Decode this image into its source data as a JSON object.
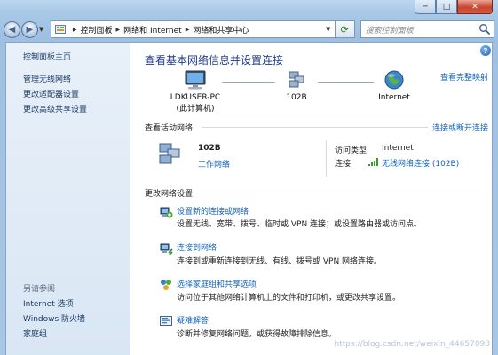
{
  "window": {
    "caption": {
      "minimize": "─",
      "maximize": "□",
      "close": "✕"
    }
  },
  "navbar": {
    "breadcrumbs": [
      "控制面板",
      "网络和 Internet",
      "网络和共享中心"
    ],
    "search_placeholder": "搜索控制面板"
  },
  "sidebar": {
    "home": "控制面板主页",
    "links": [
      "管理无线网络",
      "更改适配器设置",
      "更改高级共享设置"
    ],
    "see_also_heading": "另请参阅",
    "see_also": [
      "Internet 选项",
      "Windows 防火墙",
      "家庭组"
    ]
  },
  "main": {
    "title": "查看基本网络信息并设置连接",
    "full_map": "查看完整映射",
    "network_map": {
      "computer_name": "LDKUSER-PC",
      "computer_note": "(此计算机)",
      "network": "102B",
      "internet": "Internet"
    },
    "active": {
      "heading": "查看活动网络",
      "connect_link": "连接或断开连接",
      "network_name": "102B",
      "network_type": "工作网络",
      "access_type_label": "访问类型:",
      "access_type_value": "Internet",
      "connection_label": "连接:",
      "connection_value": "无线网络连接 (102B)"
    },
    "change": {
      "heading": "更改网络设置",
      "tasks": [
        {
          "link": "设置新的连接或网络",
          "desc": "设置无线、宽带、拨号、临时或 VPN 连接；或设置路由器或访问点。"
        },
        {
          "link": "连接到网络",
          "desc": "连接到或重新连接到无线、有线、拨号或 VPN 网络连接。"
        },
        {
          "link": "选择家庭组和共享选项",
          "desc": "访问位于其他网络计算机上的文件和打印机，或更改共享设置。"
        },
        {
          "link": "疑难解答",
          "desc": "诊断并修复网络问题，或获得故障排除信息。"
        }
      ]
    }
  },
  "watermark": "https://blog.csdn.net/weixin_44657898"
}
